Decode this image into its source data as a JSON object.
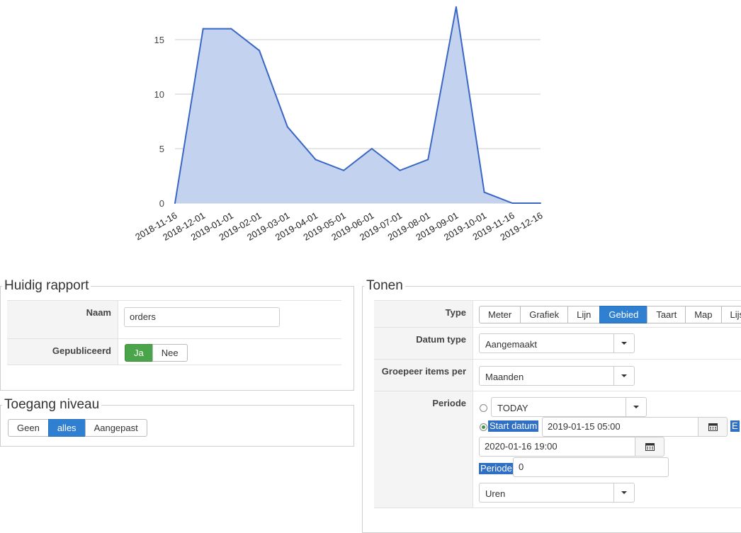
{
  "chart_data": {
    "type": "area",
    "categories": [
      "2018-11-16",
      "2018-12-01",
      "2019-01-01",
      "2019-02-01",
      "2019-03-01",
      "2019-04-01",
      "2019-05-01",
      "2019-06-01",
      "2019-07-01",
      "2019-08-01",
      "2019-09-01",
      "2019-10-01",
      "2019-11-16",
      "2019-12-16"
    ],
    "values": [
      0,
      16,
      16,
      14,
      7,
      4,
      3,
      5,
      3,
      4,
      18,
      1,
      0,
      0
    ],
    "yticks": [
      "0",
      "5",
      "10",
      "15"
    ],
    "ylim": [
      0,
      18
    ],
    "grid": true,
    "colors": {
      "line": "#3a66c4",
      "fill": "#c3d3ef",
      "grid": "#cccccc"
    }
  },
  "huidig": {
    "legend": "Huidig rapport",
    "naam_label": "Naam",
    "naam_value": "orders",
    "gepubliceerd_label": "Gepubliceerd",
    "ja": "Ja",
    "nee": "Nee"
  },
  "toegang": {
    "legend": "Toegang niveau",
    "options": [
      "Geen",
      "alles",
      "Aangepast"
    ],
    "selected": "alles"
  },
  "tonen": {
    "legend": "Tonen",
    "type_label": "Type",
    "type_options": [
      "Meter",
      "Grafiek",
      "Lijn",
      "Gebied",
      "Taart",
      "Map",
      "Lijs"
    ],
    "type_selected": "Gebied",
    "datum_type_label": "Datum type",
    "datum_type_value": "Aangemaakt",
    "groepeer_label": "Groepeer items per",
    "groepeer_value": "Maanden",
    "periode_label": "Periode",
    "periode_preset": "TODAY",
    "start_datum_label": "Start datum",
    "start_datum_value": "2019-01-15 05:00",
    "eind_label": "E",
    "eind_value": "2020-01-16 19:00",
    "periode_small_label": "Periode",
    "periode_value": "0",
    "unit_value": "Uren"
  },
  "icons": {
    "calendar": "calendar-icon",
    "caret": "chevron-down-icon"
  }
}
